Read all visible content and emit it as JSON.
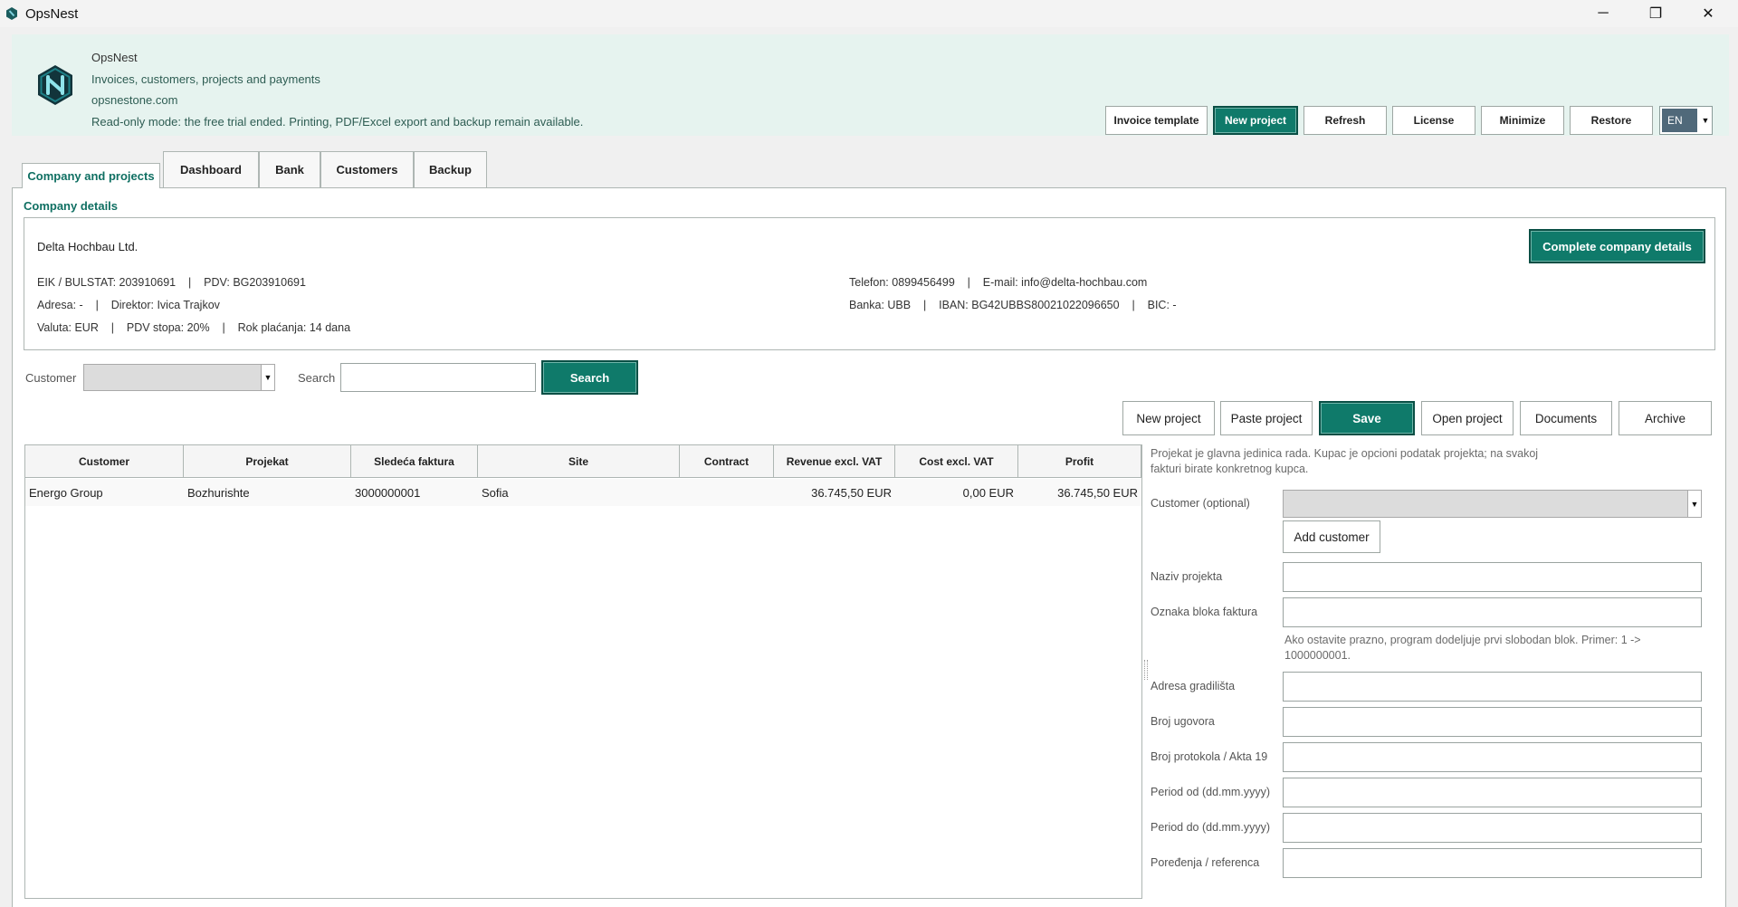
{
  "window": {
    "title": "OpsNest",
    "minimize_glyph": "─",
    "maximize_glyph": "❐",
    "close_glyph": "✕"
  },
  "header": {
    "app_name": "OpsNest",
    "tagline": "Invoices, customers, projects and payments",
    "website": "opsnestone.com",
    "notice": "Read-only mode: the free trial ended. Printing, PDF/Excel export and backup remain available.",
    "buttons": {
      "invoice_template": "Invoice template",
      "new_project": "New project",
      "refresh": "Refresh",
      "license": "License",
      "minimize": "Minimize",
      "restore": "Restore"
    },
    "language": "EN",
    "accent_color": "#0f7a6a"
  },
  "tabs": [
    "Company and projects",
    "Dashboard",
    "Bank",
    "Customers",
    "Backup"
  ],
  "company": {
    "section_title": "Company details",
    "name": "Delta Hochbau Ltd.",
    "line1_left": "EIK / BULSTAT: 203910691    |    PDV: BG203910691",
    "line2_left": "Adresa: -    |    Direktor: Ivica Trajkov",
    "line3_left": "Valuta: EUR    |    PDV stopa: 20%    |    Rok plaćanja: 14 dana",
    "line1_right": "Telefon: 0899456499    |    E-mail: info@delta-hochbau.com",
    "line2_right": "Banka: UBB    |    IBAN: BG42UBBS80021022096650    |    BIC: -",
    "complete_button": "Complete company details"
  },
  "filter": {
    "customer_label": "Customer",
    "customer_value": "",
    "search_label": "Search",
    "search_value": "",
    "search_button": "Search"
  },
  "actions": {
    "new_project": "New project",
    "paste_project": "Paste project",
    "save": "Save",
    "open_project": "Open project",
    "documents": "Documents",
    "archive": "Archive"
  },
  "table": {
    "columns": [
      "Customer",
      "Projekat",
      "Sledeća faktura",
      "Site",
      "Contract",
      "Revenue excl. VAT",
      "Cost excl. VAT",
      "Profit"
    ],
    "rows": [
      {
        "customer": "Energo Group",
        "project": "Bozhurishte",
        "next_invoice": "3000000001",
        "site": "Sofia",
        "contract": "",
        "revenue": "36.745,50 EUR",
        "cost": "0,00 EUR",
        "profit": "36.745,50 EUR"
      }
    ]
  },
  "form": {
    "intro": "Projekat je glavna jedinica rada. Kupac je opcioni podatak projekta; na svakoj fakturi birate konkretnog kupca.",
    "customer_label": "Customer (optional)",
    "customer_value": "",
    "add_customer": "Add customer",
    "project_name_label": "Naziv projekta",
    "invoice_block_label": "Oznaka bloka faktura",
    "invoice_block_hint": "Ako ostavite prazno, program dodeljuje prvi slobodan blok. Primer: 1 -> 1000000001.",
    "site_address_label": "Adresa gradilišta",
    "contract_no_label": "Broj ugovora",
    "protocol_label": "Broj protokola / Akta 19",
    "period_from_label": "Period od (dd.mm.yyyy)",
    "period_to_label": "Period do (dd.mm.yyyy)",
    "order_ref_label": "Poređenja / referenca"
  }
}
